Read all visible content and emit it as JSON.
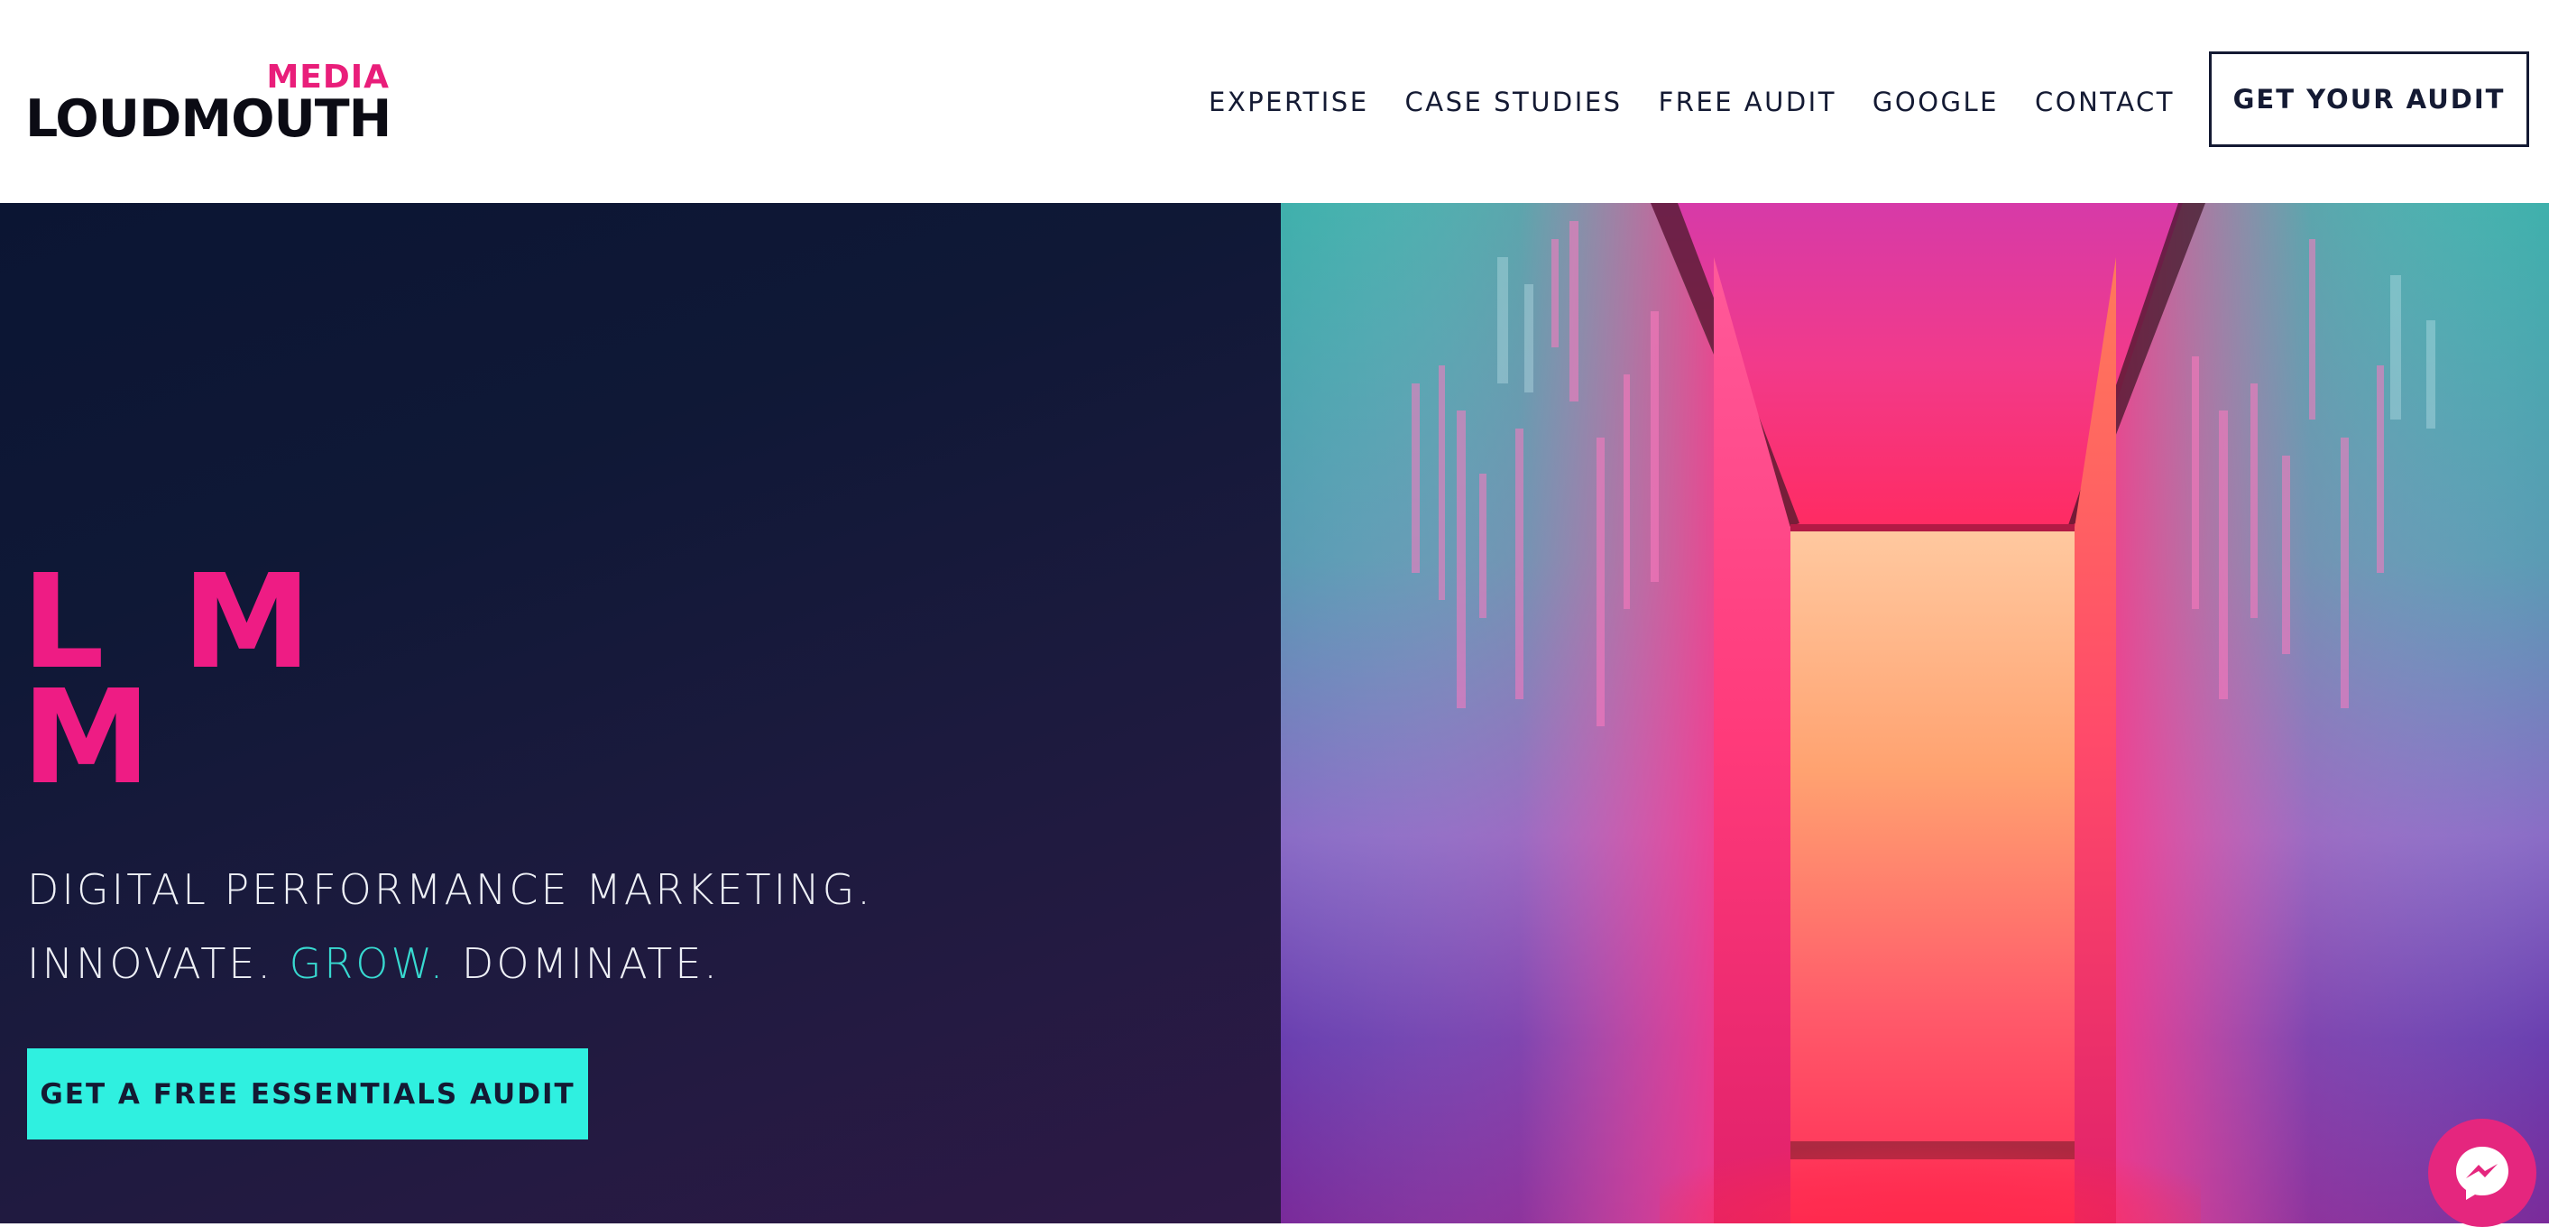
{
  "brand": {
    "logo_top": "MEDIA",
    "logo_main": "LOUDMOUTH"
  },
  "nav": {
    "items": [
      {
        "label": "EXPERTISE"
      },
      {
        "label": "CASE STUDIES"
      },
      {
        "label": "FREE AUDIT"
      },
      {
        "label": "GOOGLE"
      },
      {
        "label": "CONTACT"
      }
    ],
    "cta_label": "GET YOUR AUDIT"
  },
  "hero": {
    "monogram_row1": "L M",
    "monogram_row2": "M",
    "tagline_line1": "DIGITAL PERFORMANCE MARKETING.",
    "tagline_line2_a": "INNOVATE. ",
    "tagline_line2_accent": "GROW.",
    "tagline_line2_b": " DOMINATE.",
    "cta_label": "GET A FREE ESSENTIALS AUDIT"
  },
  "icons": {
    "messenger": "messenger-icon"
  },
  "colors": {
    "brand_pink": "#e91e7a",
    "accent_cyan": "#2ff0e0",
    "navy": "#141a33"
  }
}
